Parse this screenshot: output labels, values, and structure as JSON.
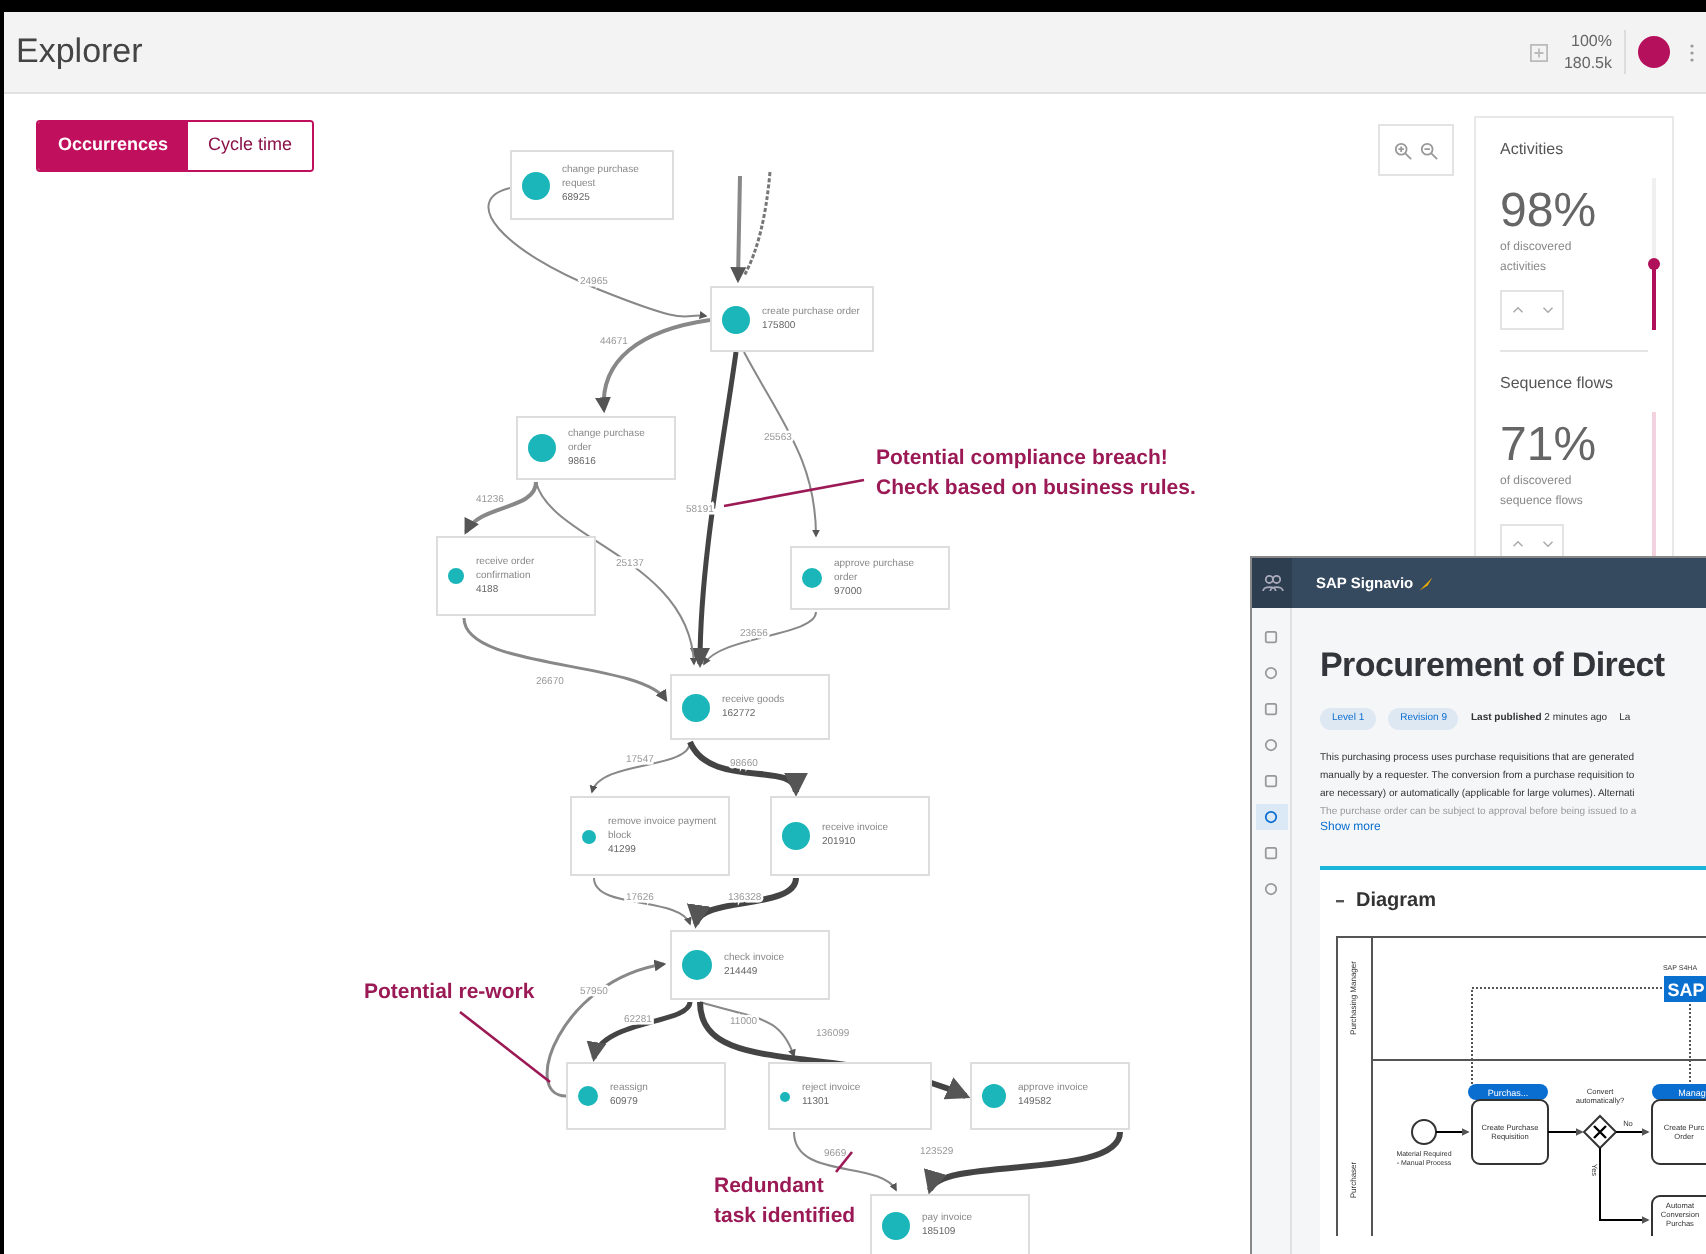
{
  "header": {
    "title": "Explorer",
    "zoom": "100%",
    "count": "180.5k"
  },
  "tabs": [
    {
      "label": "Occurrences",
      "selected": true
    },
    {
      "label": "Cycle time",
      "selected": false
    }
  ],
  "nodes": [
    {
      "label": "change purchase request",
      "count": "68925"
    },
    {
      "label": "create purchase order",
      "count": "175800"
    },
    {
      "label": "change purchase order",
      "count": "98616"
    },
    {
      "label": "receive order confirmation",
      "count": "4188"
    },
    {
      "label": "approve purchase order",
      "count": "97000"
    },
    {
      "label": "receive goods",
      "count": "162772"
    },
    {
      "label": "remove invoice payment block",
      "count": "41299"
    },
    {
      "label": "receive invoice",
      "count": "201910"
    },
    {
      "label": "check invoice",
      "count": "214449"
    },
    {
      "label": "reassign",
      "count": "60979"
    },
    {
      "label": "reject invoice",
      "count": "11301"
    },
    {
      "label": "approve invoice",
      "count": "149582"
    },
    {
      "label": "pay invoice",
      "count": "185109"
    }
  ],
  "edges": [
    {
      "label": "24965"
    },
    {
      "label": "44671"
    },
    {
      "label": "58191"
    },
    {
      "label": "25563"
    },
    {
      "label": "41236"
    },
    {
      "label": "25137"
    },
    {
      "label": "26670"
    },
    {
      "label": "23656"
    },
    {
      "label": "17547"
    },
    {
      "label": "98660"
    },
    {
      "label": "17626"
    },
    {
      "label": "136328"
    },
    {
      "label": "57950"
    },
    {
      "label": "62281"
    },
    {
      "label": "11000"
    },
    {
      "label": "136099"
    },
    {
      "label": "9669"
    },
    {
      "label": "123529"
    }
  ],
  "annotations": [
    {
      "lines": [
        "Potential compliance breach!",
        "Check based on business rules."
      ]
    },
    {
      "lines": [
        "Potential re-work"
      ]
    },
    {
      "lines": [
        "Redundant",
        "task identified"
      ]
    }
  ],
  "filters": [
    {
      "title": "Activities",
      "value": "98%",
      "caption": "of discovered activities",
      "level": 0.44
    },
    {
      "title": "Sequence flows",
      "value": "71%",
      "caption": "of discovered sequence flows"
    }
  ],
  "sap_window": {
    "brand": "SAP Signavio",
    "sidebar": [
      {
        "selected": false
      },
      {
        "selected": false
      },
      {
        "selected": false
      },
      {
        "selected": false
      },
      {
        "selected": false
      },
      {
        "selected": true
      },
      {
        "selected": false
      },
      {
        "selected": false
      }
    ],
    "title": "Procurement of Direct",
    "level_chip": "Level 1",
    "revision_chip": "Revision 9",
    "published": "**Last published** 2 minutes ago",
    "published_cut": "La",
    "description": [
      "This purchasing process uses purchase requisitions that are generated",
      "manually by a requester. The conversion from a purchase requisition to",
      "are necessary) or automatically (applicable for large volumes). Alternati"
    ],
    "faded_line": "The purchase order can be subject to approval before being issued to a",
    "show_more": "Show more",
    "section": "Diagram",
    "diagram": {
      "lanes": [
        "Purchasing Manager",
        "Purchaser"
      ],
      "system": "SAP S4HA",
      "system_logo": "SAP",
      "badges": [
        "Purchas...",
        "Manag"
      ],
      "start_label": [
        "Material Required",
        "- Manual Process"
      ],
      "task_1": [
        "Create Purchase",
        "Requisition"
      ],
      "gateway": [
        "Convert",
        "automatically?"
      ],
      "no": "No",
      "yes": "Yes",
      "task_2": [
        "Create Purc",
        "Order"
      ],
      "task_3": [
        "Automat",
        "Conversion",
        "Purchas"
      ]
    }
  }
}
